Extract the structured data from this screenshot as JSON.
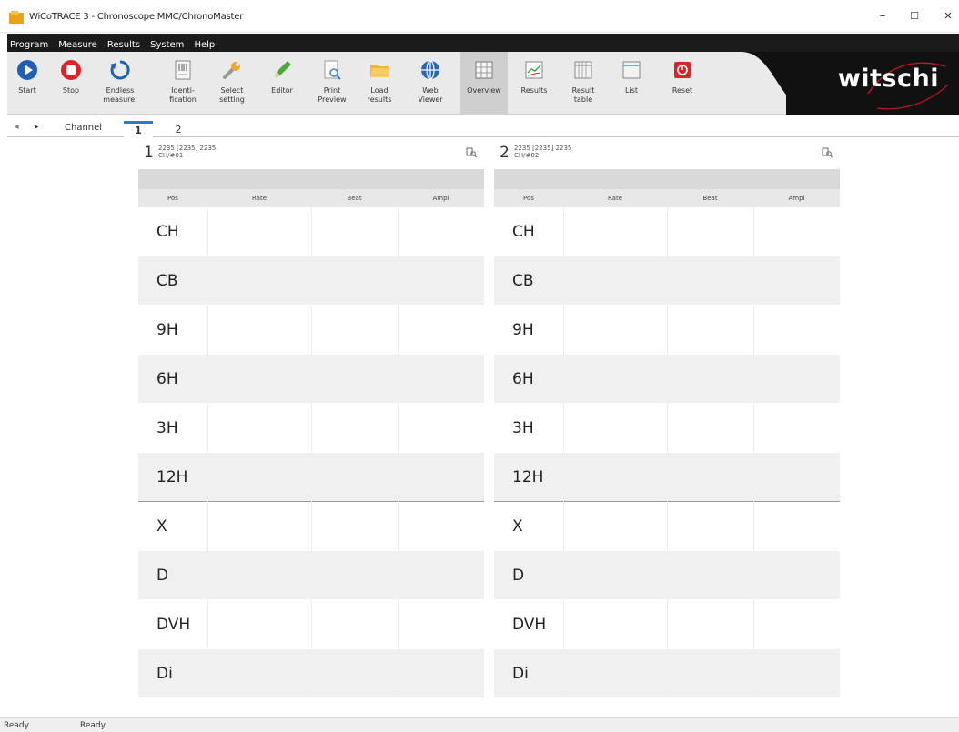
{
  "window": {
    "title": "WiCoTRACE 3 - Chronoscope MMC/ChronoMaster",
    "controls": [
      "–",
      "☐",
      "✕"
    ]
  },
  "menu": [
    "Program",
    "Measure",
    "Results",
    "System",
    "Help"
  ],
  "toolbar": {
    "buttons": [
      {
        "label": "Start",
        "icon": "play-icon"
      },
      {
        "label": "Stop",
        "icon": "stop-icon"
      },
      {
        "label": "Endless\nmeasure.",
        "icon": "endless-icon"
      },
      {
        "label": "Identi-\nfication",
        "icon": "identification-icon"
      },
      {
        "label": "Select\nsetting",
        "icon": "wrench-icon"
      },
      {
        "label": "Editor",
        "icon": "pencil-icon"
      },
      {
        "label": "Print\nPreview",
        "icon": "print-preview-icon"
      },
      {
        "label": "Load\nresults",
        "icon": "folder-icon"
      },
      {
        "label": "Web\nViewer",
        "icon": "globe-icon"
      },
      {
        "label": "Overview",
        "icon": "overview-icon"
      },
      {
        "label": "Results",
        "icon": "results-icon"
      },
      {
        "label": "Result\ntable",
        "icon": "result-table-icon"
      },
      {
        "label": "List",
        "icon": "list-icon"
      },
      {
        "label": "Reset",
        "icon": "reset-icon"
      }
    ],
    "brand": "witschi"
  },
  "tabs": {
    "channel_label": "Channel",
    "items": [
      "1",
      "2"
    ],
    "active": "1"
  },
  "panels": [
    {
      "number": "1",
      "info_line1": "2235 [2235] 2235",
      "info_line2": "CH/#01"
    },
    {
      "number": "2",
      "info_line1": "2235 [2235] 2235",
      "info_line2": "CH/#02"
    }
  ],
  "columns": [
    "Pos",
    "Rate",
    "Beat",
    "Ampl"
  ],
  "positions": [
    "CH",
    "CB",
    "9H",
    "6H",
    "3H",
    "12H",
    "X",
    "D",
    "DVH",
    "Di"
  ],
  "status": {
    "left": "Ready",
    "right": "Ready"
  },
  "colors": {
    "accent": "#2a7ad6",
    "stop": "#d9252a",
    "menubar": "#1b1b1b"
  }
}
